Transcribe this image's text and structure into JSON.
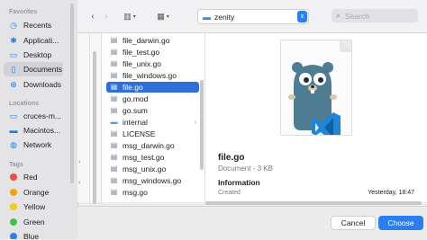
{
  "sidebar": {
    "favorites_heading": "Favorites",
    "favorites": [
      {
        "label": "Recents",
        "icon": "clock-icon"
      },
      {
        "label": "Applicati...",
        "icon": "applications-icon"
      },
      {
        "label": "Desktop",
        "icon": "desktop-icon"
      },
      {
        "label": "Documents",
        "icon": "document-icon"
      },
      {
        "label": "Downloads",
        "icon": "download-icon"
      }
    ],
    "locations_heading": "Locations",
    "locations": [
      {
        "label": "cruces-m...",
        "icon": "laptop-icon"
      },
      {
        "label": "Macintos...",
        "icon": "disk-icon"
      },
      {
        "label": "Network",
        "icon": "globe-icon"
      }
    ],
    "tags_heading": "Tags",
    "tags": [
      {
        "label": "Red",
        "color": "#f24b3f"
      },
      {
        "label": "Orange",
        "color": "#f5a30a"
      },
      {
        "label": "Yellow",
        "color": "#f2cd13"
      },
      {
        "label": "Green",
        "color": "#43bf4a"
      },
      {
        "label": "Blue",
        "color": "#2a7ef0"
      }
    ]
  },
  "toolbar": {
    "path": "zenity",
    "search_placeholder": "Search"
  },
  "files": [
    {
      "name": "file_darwin.go",
      "type": "file"
    },
    {
      "name": "file_test.go",
      "type": "file"
    },
    {
      "name": "file_unix.go",
      "type": "file"
    },
    {
      "name": "file_windows.go",
      "type": "file"
    },
    {
      "name": "file.go",
      "type": "file",
      "selected": true
    },
    {
      "name": "go.mod",
      "type": "file"
    },
    {
      "name": "go.sum",
      "type": "file"
    },
    {
      "name": "internal",
      "type": "folder"
    },
    {
      "name": "LICENSE",
      "type": "file"
    },
    {
      "name": "msg_darwin.go",
      "type": "file"
    },
    {
      "name": "msg_test.go",
      "type": "file"
    },
    {
      "name": "msg_unix.go",
      "type": "file"
    },
    {
      "name": "msg_windows.go",
      "type": "file"
    },
    {
      "name": "msg.go",
      "type": "file"
    }
  ],
  "preview": {
    "name": "file.go",
    "kind": "Document - 3 KB",
    "info_heading": "Information",
    "created_label": "Created",
    "created_value": "Yesterday, 18:47"
  },
  "footer": {
    "cancel_label": "Cancel",
    "choose_label": "Choose"
  },
  "colors": {
    "accent": "#2a7ef0",
    "selection": "#2f6fd6",
    "gopher": "#4e7c93",
    "vscode": "#1f86d6"
  }
}
